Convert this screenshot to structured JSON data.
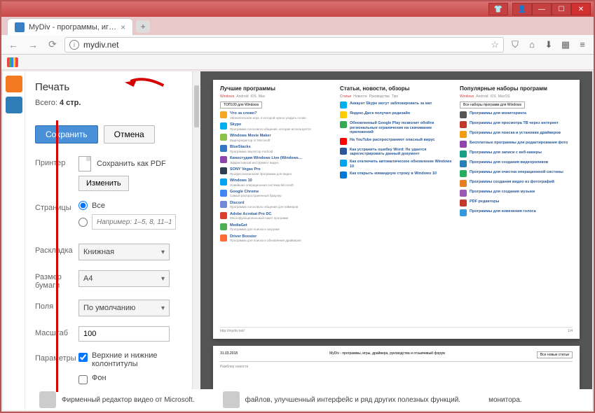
{
  "browser": {
    "tab_title": "MyDiv - программы, иг…",
    "url": "mydiv.net",
    "tab_add": "+",
    "titlebar_icons": [
      "shirt",
      "user",
      "min",
      "max",
      "close"
    ]
  },
  "print": {
    "title": "Печать",
    "total_prefix": "Всего: ",
    "total_value": "4 стр.",
    "btn_save": "Сохранить",
    "btn_cancel": "Отмена"
  },
  "settings": {
    "printer_label": "Принтер",
    "pdf_text": "Сохранить как PDF",
    "change_btn": "Изменить",
    "pages_label": "Страницы",
    "pages_all": "Все",
    "pages_range_placeholder": "Например: 1–5, 8, 11–13",
    "layout_label": "Раскладка",
    "layout_value": "Книжная",
    "paper_label": "Размер бумаги",
    "paper_value": "A4",
    "margins_label": "Поля",
    "margins_value": "По умолчанию",
    "scale_label": "Масштаб",
    "scale_value": "100",
    "options_label": "Параметры",
    "opt_headers": "Верхние и нижние колонтитулы",
    "opt_bg": "Фон"
  },
  "preview": {
    "col1_title": "Лучшие программы",
    "col2_title": "Статьи, новости, обзоры",
    "col3_title": "Популярные наборы программ",
    "tabs": [
      "Windows",
      "Android",
      "iOS",
      "Mac"
    ],
    "tabs3": [
      "Windows",
      "Android",
      "iOS",
      "MacOS"
    ],
    "col1_btn": "ТОП100 для Windows",
    "col3_btn": "Все наборы программ для Windows",
    "footer_url": "http://mydiv.net/",
    "footer_page": "1/4",
    "pg2_date": "31.03.2018",
    "pg2_title": "MyDiv - программы, игры, драйвера, руководства и отзывчивый форум",
    "pg2_btn": "Все новые статьи",
    "col1_items": [
      {
        "t": "Что за слово?",
        "d": "Увлекательная игра, в которой нужно угадать слово",
        "c": "#f5a623"
      },
      {
        "t": "Skype",
        "d": "Программа голосового общения, которая используется",
        "c": "#00aff0"
      },
      {
        "t": "Windows Movie Maker",
        "d": "Видеоредактор от Microsoft",
        "c": "#8bc34a"
      },
      {
        "t": "BlueStacks",
        "d": "Программа эмулятор Android",
        "c": "#3478c4"
      },
      {
        "t": "Киностудия Windows Live (Windows…",
        "d": "Эффективный инструмент видео",
        "c": "#8e44ad"
      },
      {
        "t": "SONY Vegas Pro",
        "d": "Профессиональная программа для видео",
        "c": "#2c3e50"
      },
      {
        "t": "Windows 10",
        "d": "Новейшая операционная система Microsoft",
        "c": "#00a4ef"
      },
      {
        "t": "Google Chrome",
        "d": "Самый распространенный браузер",
        "c": "#4285f4"
      },
      {
        "t": "Discord",
        "d": "Программа голосового общения для геймеров",
        "c": "#7289da"
      },
      {
        "t": "Adobe Acrobat Pro DC",
        "d": "Многофункциональный пакет программ",
        "c": "#dc3e2e"
      },
      {
        "t": "MediaGet",
        "d": "Программа для поиска и загрузки",
        "c": "#4caf50"
      },
      {
        "t": "Driver Booster",
        "d": "Программа для поиска и обновления драйверов",
        "c": "#ff6b35"
      }
    ],
    "col2_tabs": [
      "Статьи",
      "Новости",
      "Руководства",
      "Tips"
    ],
    "col2_items": [
      {
        "t": "Аккаунт Skype могут заблокировать за мат",
        "c": "#00aff0"
      },
      {
        "t": "Яндекс.Диск получил редизайн",
        "c": "#ffcc00"
      },
      {
        "t": "Обновленный Google Play позволит обойти региональные ограничения на скачивание приложений",
        "c": "#34a853"
      },
      {
        "t": "На YouTube распространяют опасный вирус",
        "c": "#ff0000"
      },
      {
        "t": "Как устранить ошибку Word: Не удается зарегистрировать данный документ",
        "c": "#2b579a"
      },
      {
        "t": "Как отключить автоматическое обновление Windows 10",
        "c": "#00a4ef"
      },
      {
        "t": "Как открыть командную строку в Windows 10",
        "c": "#0078d7"
      }
    ],
    "col3_items": [
      {
        "t": "Программы для мониторинга",
        "c": "#555"
      },
      {
        "t": "Программы для просмотра ТВ через интернет",
        "c": "#c0392b"
      },
      {
        "t": "Программы для поиска и установки драйверов",
        "c": "#f39c12"
      },
      {
        "t": "Бесплатные программы для редактирования фото",
        "c": "#8e44ad"
      },
      {
        "t": "Программы для записи с веб-камеры",
        "c": "#16a085"
      },
      {
        "t": "Программы для создания видеороликов",
        "c": "#2980b9"
      },
      {
        "t": "Программы для очистки операционной системы",
        "c": "#27ae60"
      },
      {
        "t": "Программы создания видео из фотографий",
        "c": "#e67e22"
      },
      {
        "t": "Программы для создания музыки",
        "c": "#9b59b6"
      },
      {
        "t": "PDF редакторы",
        "c": "#c0392b"
      },
      {
        "t": "Программы для изменения голоса",
        "c": "#3498db"
      }
    ]
  },
  "page_bottom": {
    "item1": "Фирменный редактор видео от Microsoft.",
    "item2": "файлов, улучшенный интерфейс и ряд других полезных функций.",
    "item3": "монитора."
  }
}
